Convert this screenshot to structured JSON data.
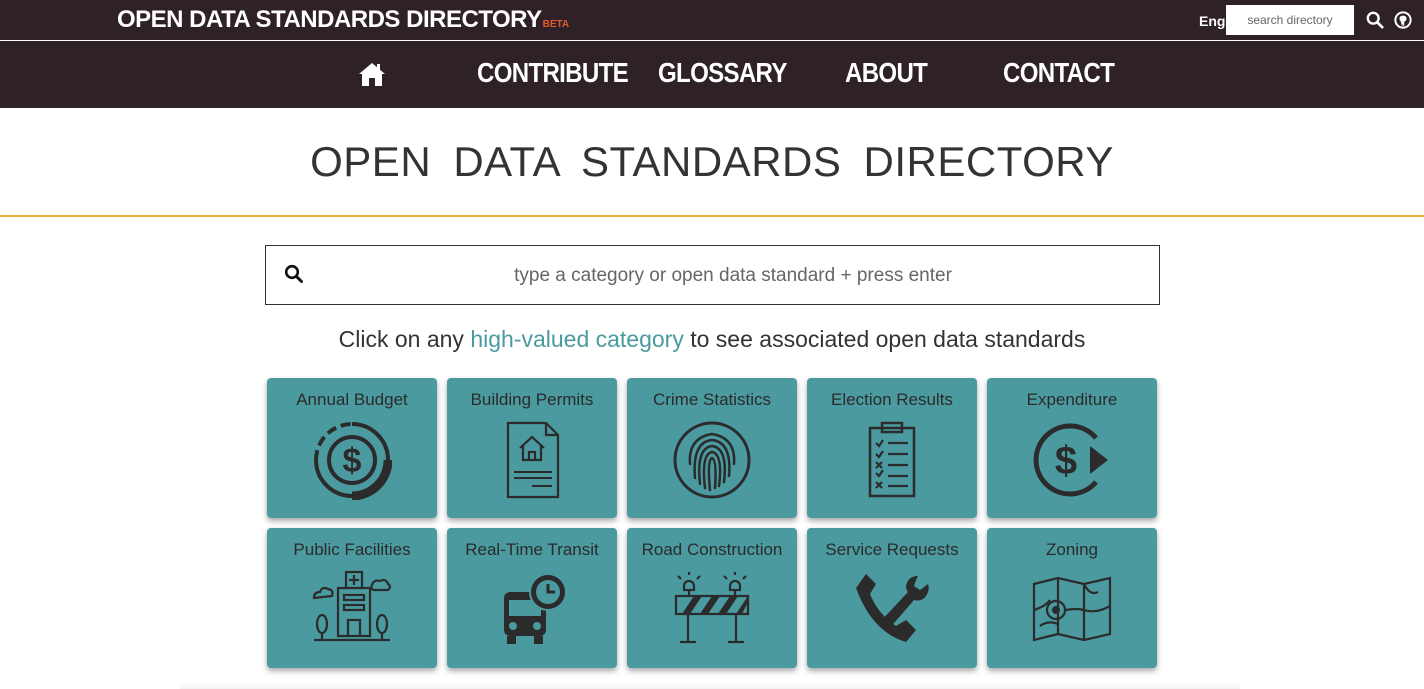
{
  "header": {
    "brand": "OPEN DATA STANDARDS DIRECTORY",
    "beta": "BETA",
    "language": "Eng",
    "search_placeholder": "search directory",
    "icons": [
      "search-icon",
      "github-icon"
    ]
  },
  "nav": {
    "home_icon": "home-icon",
    "items": [
      {
        "label": "CONTRIBUTE"
      },
      {
        "label": "GLOSSARY"
      },
      {
        "label": "ABOUT"
      },
      {
        "label": "CONTACT"
      }
    ]
  },
  "main": {
    "title": "OPEN DATA STANDARDS DIRECTORY",
    "search_placeholder": "type a category or open data standard + press enter",
    "tagline_before": "Click on any ",
    "tagline_link": "high-valued category",
    "tagline_after": " to see associated open data standards",
    "categories": [
      {
        "label": "Annual Budget",
        "icon": "budget-dollar-cycle-icon"
      },
      {
        "label": "Building Permits",
        "icon": "building-permit-document-icon"
      },
      {
        "label": "Crime Statistics",
        "icon": "fingerprint-icon"
      },
      {
        "label": "Election Results",
        "icon": "clipboard-checklist-icon"
      },
      {
        "label": "Expenditure",
        "icon": "dollar-arrow-icon"
      },
      {
        "label": "Public Facilities",
        "icon": "hospital-building-icon"
      },
      {
        "label": "Real-Time Transit",
        "icon": "bus-clock-icon"
      },
      {
        "label": "Road Construction",
        "icon": "road-barrier-icon"
      },
      {
        "label": "Service Requests",
        "icon": "phone-wrench-icon"
      },
      {
        "label": "Zoning",
        "icon": "zoning-map-icon"
      }
    ]
  },
  "colors": {
    "header_bg": "#2e2128",
    "tile_bg": "#4a9aa0",
    "accent_link": "#4a9aa0",
    "gold_rule": "#e6b245",
    "beta": "#e05a2a"
  }
}
